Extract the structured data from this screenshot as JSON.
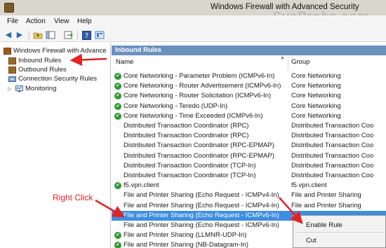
{
  "window": {
    "title": "Windows Firewall with Advanced Security"
  },
  "watermark": "SysProbs.com",
  "menu": [
    "File",
    "Action",
    "View",
    "Help"
  ],
  "toolbar": {
    "buttons": [
      "back-arrow-icon",
      "forward-arrow-icon",
      "up-folder-icon",
      "show-hide-tree-icon",
      "export-list-icon",
      "help-icon",
      "properties-icon"
    ]
  },
  "tree": {
    "root": "Windows Firewall with Advance",
    "items": [
      "Inbound Rules",
      "Outbound Rules",
      "Connection Security Rules",
      "Monitoring"
    ]
  },
  "pane": {
    "header": "Inbound Rules",
    "columns": {
      "name": "Name",
      "group": "Group"
    },
    "rows": [
      {
        "name": "Core Networking - Parameter Problem (ICMPv6-In)",
        "group": "Core Networking",
        "enabled": true
      },
      {
        "name": "Core Networking - Router Advertisement (ICMPv6-In)",
        "group": "Core Networking",
        "enabled": true
      },
      {
        "name": "Core Networking - Router Solicitation (ICMPv6-In)",
        "group": "Core Networking",
        "enabled": true
      },
      {
        "name": "Core Networking - Teredo (UDP-In)",
        "group": "Core Networking",
        "enabled": true
      },
      {
        "name": "Core Networking - Time Exceeded (ICMPv6-In)",
        "group": "Core Networking",
        "enabled": true
      },
      {
        "name": "Distributed Transaction Coordinator (RPC)",
        "group": "Distributed Transaction Coo",
        "enabled": false
      },
      {
        "name": "Distributed Transaction Coordinator (RPC)",
        "group": "Distributed Transaction Coo",
        "enabled": false
      },
      {
        "name": "Distributed Transaction Coordinator (RPC-EPMAP)",
        "group": "Distributed Transaction Coo",
        "enabled": false
      },
      {
        "name": "Distributed Transaction Coordinator (RPC-EPMAP)",
        "group": "Distributed Transaction Coo",
        "enabled": false
      },
      {
        "name": "Distributed Transaction Coordinator (TCP-In)",
        "group": "Distributed Transaction Coo",
        "enabled": false
      },
      {
        "name": "Distributed Transaction Coordinator (TCP-In)",
        "group": "Distributed Transaction Coo",
        "enabled": false
      },
      {
        "name": "f5.vpn.client",
        "group": "f5.vpn.client",
        "enabled": true
      },
      {
        "name": "File and Printer Sharing (Echo Request - ICMPv4-In)",
        "group": "File and Printer Sharing",
        "enabled": false
      },
      {
        "name": "File and Printer Sharing (Echo Request - ICMPv4-In)",
        "group": "File and Printer Sharing",
        "enabled": false
      },
      {
        "name": "File and Printer Sharing (Echo Request - ICMPv6-In)",
        "group": "",
        "enabled": false,
        "selected": true
      },
      {
        "name": "File and Printer Sharing (Echo Request - ICMPv6-In)",
        "group": "",
        "enabled": false
      },
      {
        "name": "File and Printer Sharing (LLMNR-UDP-In)",
        "group": "",
        "enabled": true
      },
      {
        "name": "File and Printer Sharing (NB-Datagram-In)",
        "group": "",
        "enabled": true
      }
    ]
  },
  "context_menu": {
    "items": [
      "Enable Rule",
      "Cut"
    ]
  },
  "annotation": {
    "label": "Right Click",
    "color": "#e22323"
  },
  "colors": {
    "pane_header": "#6d91bd",
    "selection": "#3d8ee0",
    "enabled_icon": "#2e9a33"
  }
}
